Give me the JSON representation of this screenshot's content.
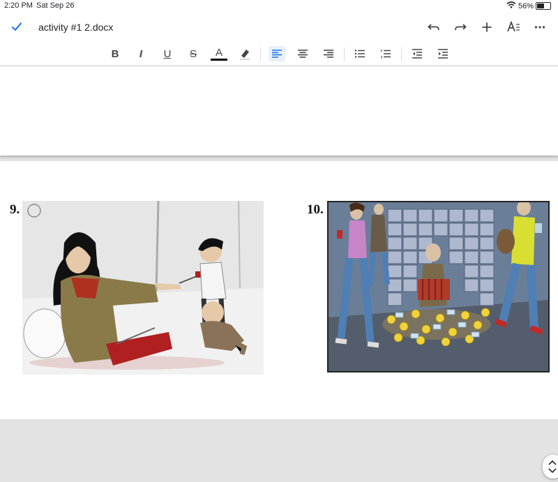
{
  "status_bar": {
    "time": "2:20 PM",
    "date": "Sat Sep 26",
    "battery": "56%",
    "battery_level": 0.56
  },
  "app_bar": {
    "title": "activity #1 2.docx"
  },
  "format_icons": {
    "bold": "B",
    "italic": "I",
    "underline": "U",
    "strike": "S",
    "text_color": "A"
  },
  "accent_color": "#1a73e8",
  "items": [
    {
      "number": "9."
    },
    {
      "number": "10."
    }
  ]
}
